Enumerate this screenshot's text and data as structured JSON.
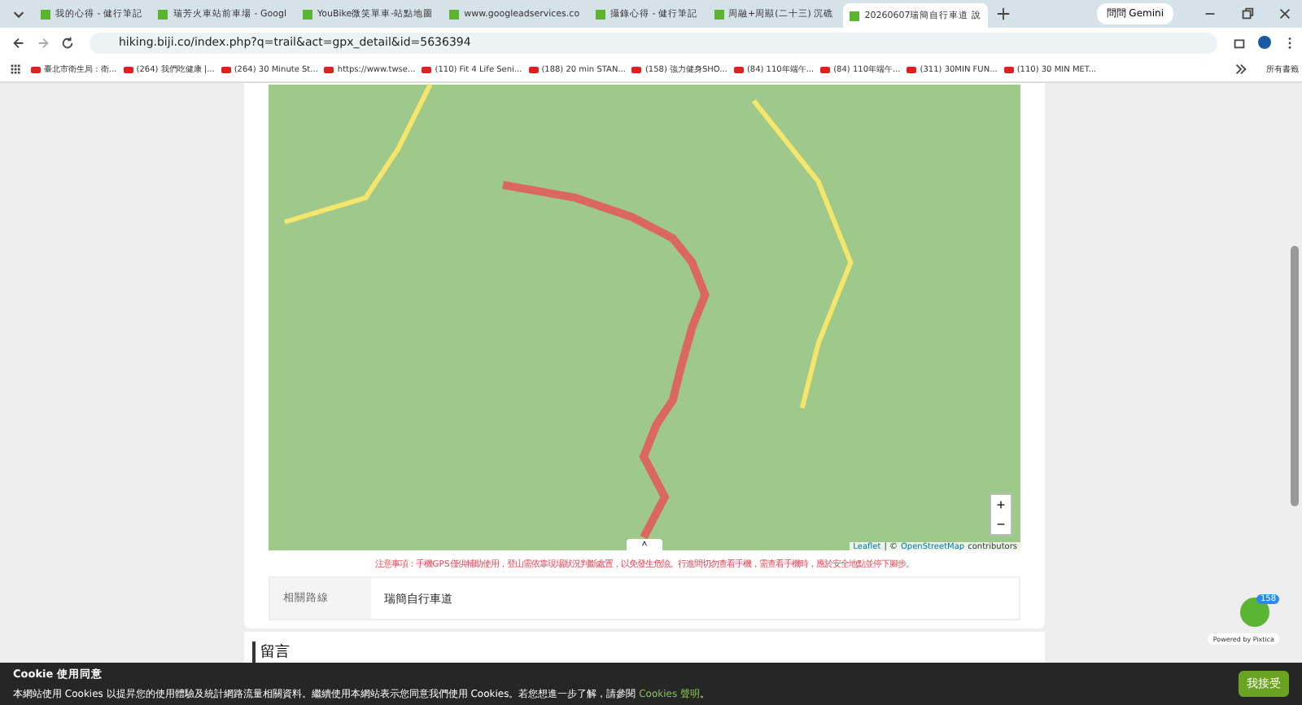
{
  "tabs": [
    {
      "label": "我的心得 - 健行筆記",
      "selected": false
    },
    {
      "label": "瑞芳火車站前車場 - Googl",
      "selected": false
    },
    {
      "label": "YouBike微笑單車-站點地圖",
      "selected": false
    },
    {
      "label": "www.googleadservices.co",
      "selected": false
    },
    {
      "label": "攝錄心得 - 健行筆記",
      "selected": false
    },
    {
      "label": "周融+周顯(二十三) 沉礁",
      "selected": false
    },
    {
      "label": "20260607瑞簡自行車道 說",
      "selected": true
    }
  ],
  "gemini": "問問 Gemini",
  "url": "hiking.biji.co/index.php?q=trail&act=gpx_detail&id=5636394",
  "bookmarks": [
    "臺北市衛生局：衛...",
    "(264) 我們吃健康 |...",
    "(264) 30 Minute St...",
    "https://www.twse...",
    "(110) Fit 4 Life Seni...",
    "(188) 20 min STAN...",
    "(158) 強力健身SHO...",
    "(84) 110年端午...",
    "(84) 110年端午...",
    "(311) 30MIN FUN...",
    "(110) 30 MIN MET..."
  ],
  "all_bookmarks": "所有書籤",
  "map": {
    "attribution_link": "Leaflet",
    "attribution_sep": "| ©",
    "attribution_osm": "OpenStreetMap",
    "attribution_rest": "contributors",
    "zoom_in": "+",
    "zoom_out": "−",
    "collapse": "˄"
  },
  "warning": "注意事項：手機GPS僅供輔助使用，登山需依靠現場狀況判斷處置，以免發生危險。行進間切勿查看手機，需查看手機時，應於安全地點並停下腳步。",
  "related": {
    "label": "相關路線",
    "value": "瑞簡自行車道"
  },
  "comments_heading": "留言",
  "badge": "158",
  "powered": "Powered by Pixtica",
  "cookie": {
    "title": "Cookie 使用同意",
    "text": "本網站使用 Cookies 以提昇您的使用體驗及統計網路流量相關資料。繼續使用本網站表示您同意我們使用 Cookies。若您想進一步了解，請參閱",
    "link": "Cookies 聲明",
    "end": "。",
    "button": "我接受"
  }
}
